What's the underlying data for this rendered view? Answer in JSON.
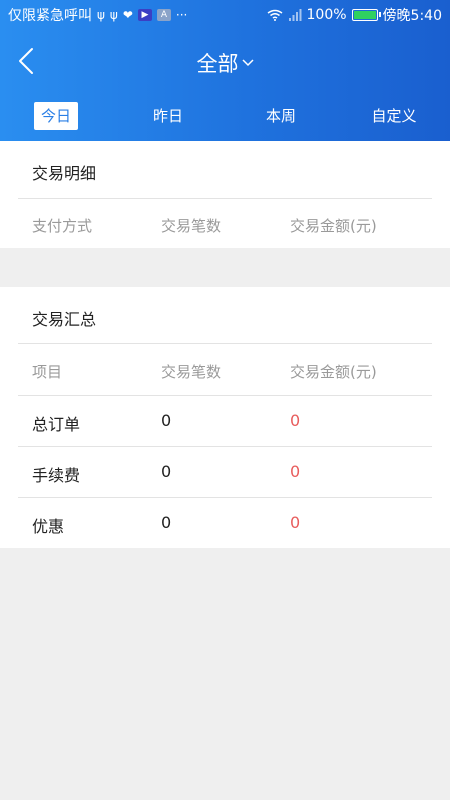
{
  "status_bar": {
    "left_text": "仅限紧急呼叫",
    "right_battery": "100%",
    "time": "傍晚5:40",
    "icons": [
      "usb-icon",
      "usb-icon",
      "heart-rate-icon",
      "play-store-icon",
      "a-app-icon",
      "more-dots-icon",
      "wifi-icon",
      "signal-icon",
      "battery-icon"
    ]
  },
  "header": {
    "title": "全部",
    "back_icon": "chevron-left-icon",
    "dropdown_icon": "chevron-down-icon"
  },
  "tabs": [
    {
      "label": "今日",
      "active": true
    },
    {
      "label": "昨日",
      "active": false
    },
    {
      "label": "本周",
      "active": false
    },
    {
      "label": "自定义",
      "active": false
    }
  ],
  "details": {
    "title": "交易明细",
    "columns": [
      "支付方式",
      "交易笔数",
      "交易金额(元)"
    ]
  },
  "summary": {
    "title": "交易汇总",
    "columns": [
      "项目",
      "交易笔数",
      "交易金额(元)"
    ],
    "rows": [
      {
        "item": "总订单",
        "count": "0",
        "amount": "0"
      },
      {
        "item": "手续费",
        "count": "0",
        "amount": "0"
      },
      {
        "item": "优惠",
        "count": "0",
        "amount": "0"
      }
    ]
  },
  "colors": {
    "header_start": "#2a8ef0",
    "header_end": "#1a5fcf",
    "amount_red": "#e85d5d",
    "page_bg": "#efefef"
  }
}
